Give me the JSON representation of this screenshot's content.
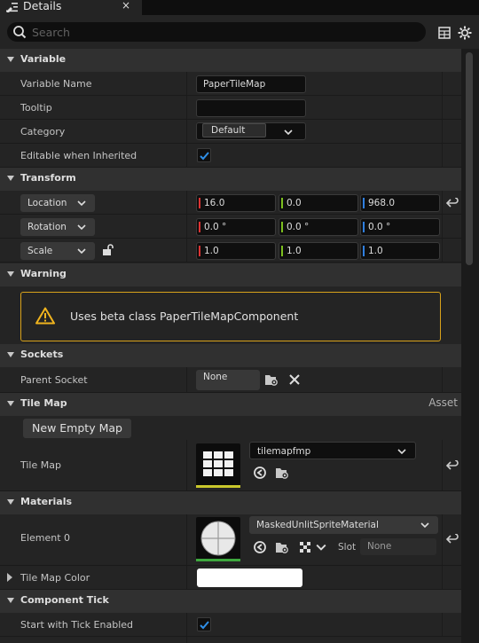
{
  "tab": {
    "title": "Details",
    "close": "×"
  },
  "search": {
    "placeholder": "Search"
  },
  "categories": {
    "variable": "Variable",
    "transform": "Transform",
    "warning": "Warning",
    "sockets": "Sockets",
    "tile_map": "Tile Map",
    "tile_map_extra": "Asset",
    "materials": "Materials",
    "component_tick": "Component Tick"
  },
  "variable": {
    "name_label": "Variable Name",
    "name_value": "PaperTileMap",
    "tooltip_label": "Tooltip",
    "tooltip_value": "",
    "category_label": "Category",
    "category_value": "Default",
    "editable_label": "Editable when Inherited",
    "editable_checked": true
  },
  "transform": {
    "location_label": "Location",
    "location": [
      "16.0",
      "0.0",
      "968.0"
    ],
    "rotation_label": "Rotation",
    "rotation": [
      "0.0 °",
      "0.0 °",
      "0.0 °"
    ],
    "scale_label": "Scale",
    "scale": [
      "1.0",
      "1.0",
      "1.0"
    ]
  },
  "warning": {
    "text": "Uses beta class PaperTileMapComponent"
  },
  "sockets": {
    "parent_label": "Parent Socket",
    "parent_value": "None"
  },
  "tile_map": {
    "new_button": "New Empty Map",
    "label": "Tile Map",
    "asset": "tilemapfmp"
  },
  "materials": {
    "element_label": "Element 0",
    "asset": "MaskedUnlitSpriteMaterial",
    "slot_label": "Slot",
    "slot_value": "None",
    "color_label": "Tile Map Color"
  },
  "component_tick": {
    "start_label": "Start with Tick Enabled",
    "start_checked": true
  },
  "colors": {
    "accent_x": "#dd3333",
    "accent_y": "#7cbf1e",
    "accent_z": "#2f7fe0",
    "warning": "#d8a21b",
    "checkbox": "#2f8fe8"
  }
}
